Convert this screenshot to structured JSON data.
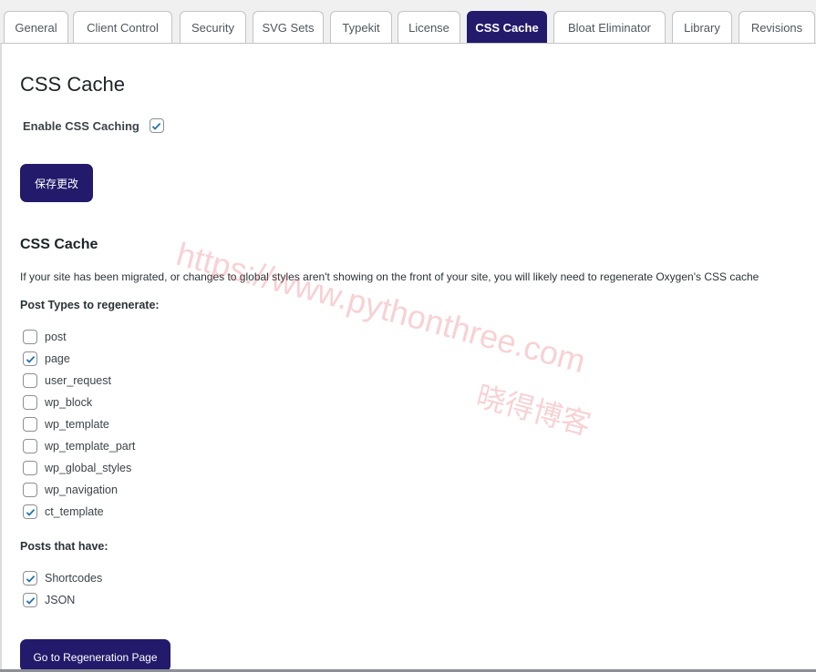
{
  "tabs": [
    {
      "label": "General",
      "active": false
    },
    {
      "label": "Client Control",
      "active": false
    },
    {
      "label": "Security",
      "active": false
    },
    {
      "label": "SVG Sets",
      "active": false
    },
    {
      "label": "Typekit",
      "active": false
    },
    {
      "label": "License",
      "active": false
    },
    {
      "label": "CSS Cache",
      "active": true
    },
    {
      "label": "Bloat Eliminator",
      "active": false
    },
    {
      "label": "Library",
      "active": false
    },
    {
      "label": "Revisions",
      "active": false
    }
  ],
  "page_title": "CSS Cache",
  "enable": {
    "label": "Enable CSS Caching",
    "checked": true
  },
  "save_label": "保存更改",
  "section_title": "CSS Cache",
  "description": "If your site has been migrated, or changes to global styles aren't showing on the front of your site, you will likely need to regenerate Oxygen's CSS cache",
  "post_types_label": "Post Types to regenerate:",
  "post_types": [
    {
      "label": "post",
      "checked": false
    },
    {
      "label": "page",
      "checked": true
    },
    {
      "label": "user_request",
      "checked": false
    },
    {
      "label": "wp_block",
      "checked": false
    },
    {
      "label": "wp_template",
      "checked": false
    },
    {
      "label": "wp_template_part",
      "checked": false
    },
    {
      "label": "wp_global_styles",
      "checked": false
    },
    {
      "label": "wp_navigation",
      "checked": false
    },
    {
      "label": "ct_template",
      "checked": true
    }
  ],
  "posts_that_have_label": "Posts that have:",
  "posts_that_have": [
    {
      "label": "Shortcodes",
      "checked": true
    },
    {
      "label": "JSON",
      "checked": true
    }
  ],
  "regen_label": "Go to Regeneration Page",
  "watermark": {
    "url": "https://www.pythonthree.com",
    "name": "晓得博客"
  },
  "colors": {
    "accent": "#231a6b",
    "check": "#2271b1"
  }
}
